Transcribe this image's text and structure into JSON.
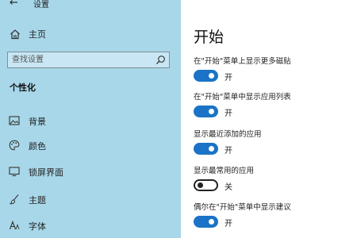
{
  "window": {
    "back_glyph": "←",
    "title": "设置"
  },
  "sidebar": {
    "home_label": "主页",
    "search": {
      "placeholder": "查找设置"
    },
    "section_heading": "个性化",
    "items": [
      {
        "label": "背景",
        "icon": "picture-icon"
      },
      {
        "label": "颜色",
        "icon": "palette-icon"
      },
      {
        "label": "锁屏界面",
        "icon": "monitor-icon"
      },
      {
        "label": "主题",
        "icon": "brush-icon"
      },
      {
        "label": "字体",
        "icon": "font-icon"
      }
    ]
  },
  "main": {
    "title": "开始",
    "settings": [
      {
        "label": "在\"开始\"菜单上显示更多磁贴",
        "state": "开",
        "on": true
      },
      {
        "label": "在\"开始\"菜单中显示应用列表",
        "state": "开",
        "on": true
      },
      {
        "label": "显示最近添加的应用",
        "state": "开",
        "on": true
      },
      {
        "label": "显示最常用的应用",
        "state": "关",
        "on": false
      },
      {
        "label": "偶尔在\"开始\"菜单中显示建议",
        "state": "开",
        "on": true
      }
    ]
  },
  "colors": {
    "sidebar": "#a8d7e9",
    "toggle_on": "#1a73c6"
  }
}
